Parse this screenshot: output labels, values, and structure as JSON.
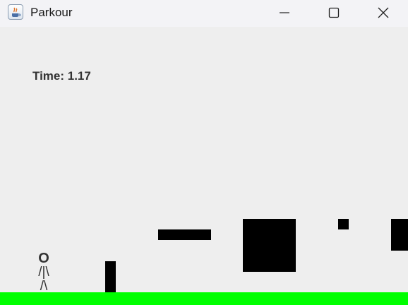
{
  "window": {
    "title": "Parkour",
    "app_icon": "java-icon",
    "controls": [
      "minimize-icon",
      "maximize-icon",
      "close-icon"
    ]
  },
  "game": {
    "time_label": "Time: 1.17",
    "player": {
      "head": "O",
      "body": "/|\\",
      "legs": "/\\"
    },
    "colors": {
      "background": "#eeeeee",
      "ground": "#00ff00",
      "obstacle": "#000000",
      "text": "#333333"
    }
  }
}
